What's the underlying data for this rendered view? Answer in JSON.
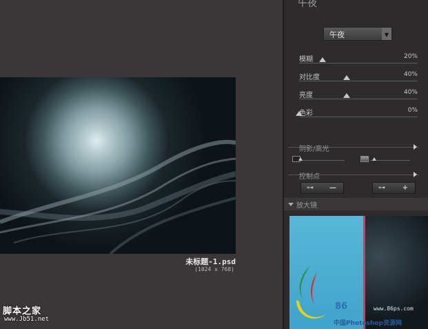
{
  "panel": {
    "title": "午夜",
    "preset_select": "午夜",
    "preset_arrow_icon": "chevron-down-icon",
    "sliders": [
      {
        "label": "模糊",
        "value": "20%",
        "level": 0.2
      },
      {
        "label": "对比度",
        "value": "40%",
        "level": 0.4
      },
      {
        "label": "亮度",
        "value": "40%",
        "level": 0.4
      },
      {
        "label": "色彩",
        "value": "0%",
        "level": 0.0
      }
    ],
    "shadows_highlights_label": "阴影/高光",
    "control_points_label": "控制点",
    "add_point_button_sign": "—",
    "remove_point_button_sign": "+",
    "loupe_label": "放大镜"
  },
  "canvas": {
    "file_name": "未标题-1.psd",
    "file_dims": "(1024 x 768)"
  },
  "watermarks": {
    "left_title": "脚本之家",
    "left_url": "www.Jb51.net",
    "right_brand": "86",
    "right_url": "www.86ps.com",
    "right_cn": "中国Photoshop资源网"
  },
  "colors": {
    "panel_bg": "#2e2b2c",
    "canvas_bg": "#3b3638",
    "accent_line": "#d8376a"
  }
}
